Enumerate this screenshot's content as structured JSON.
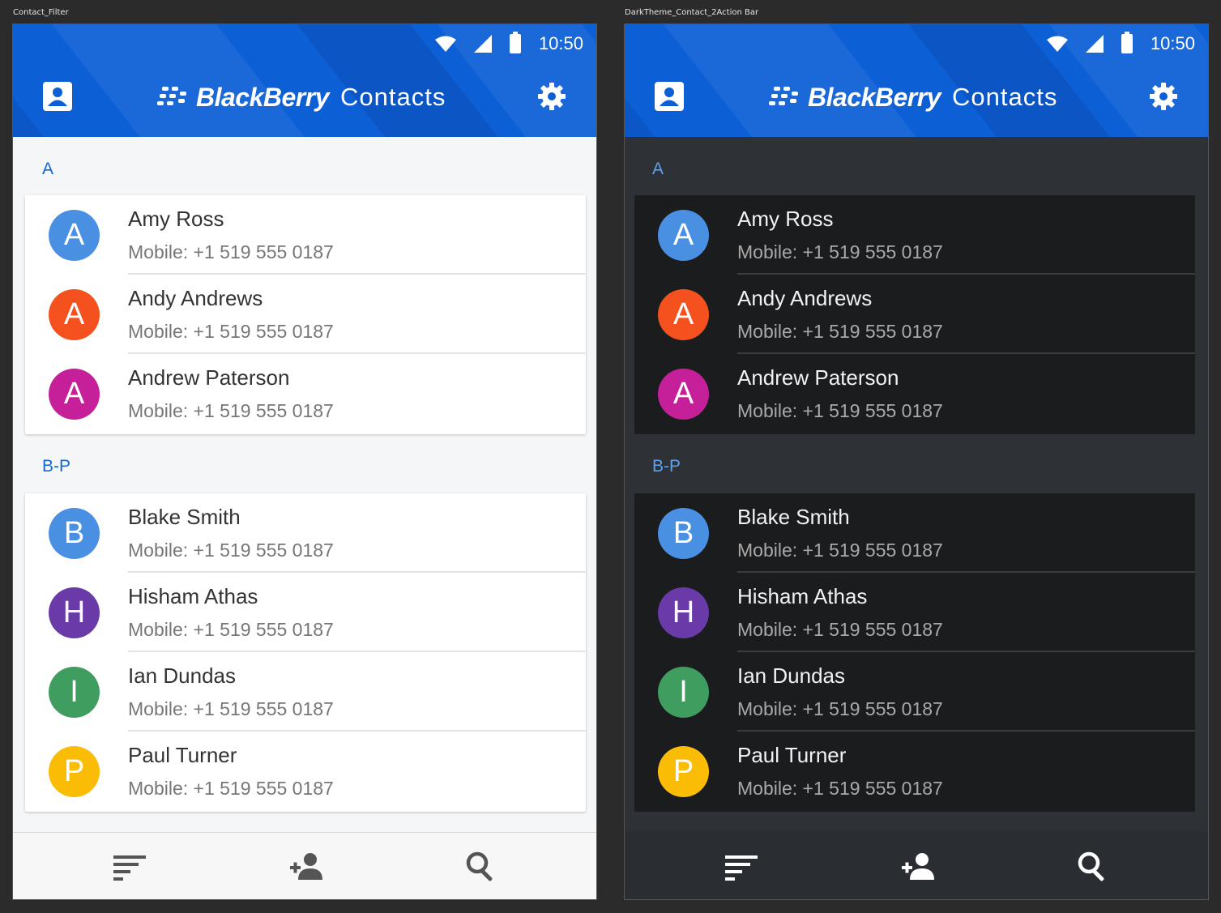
{
  "artboards": [
    {
      "title": "Contact_Filter",
      "theme": "light",
      "status": {
        "time": "10:50"
      },
      "header": {
        "brand": "BlackBerry",
        "app": "Contacts"
      },
      "sections": [
        {
          "label": "A",
          "contacts": [
            {
              "initial": "A",
              "name": "Amy Ross",
              "phone": "Mobile: +1 519 555 0187",
              "color": "#4a90e2"
            },
            {
              "initial": "A",
              "name": "Andy Andrews",
              "phone": "Mobile: +1 519 555 0187",
              "color": "#f4511e"
            },
            {
              "initial": "A",
              "name": "Andrew Paterson",
              "phone": "Mobile: +1 519 555 0187",
              "color": "#c51f9a"
            }
          ]
        },
        {
          "label": "B-P",
          "contacts": [
            {
              "initial": "B",
              "name": "Blake Smith",
              "phone": "Mobile: +1 519 555 0187",
              "color": "#4a90e2"
            },
            {
              "initial": "H",
              "name": "Hisham Athas",
              "phone": "Mobile: +1 519 555 0187",
              "color": "#6a3aa8"
            },
            {
              "initial": "I",
              "name": "Ian Dundas",
              "phone": "Mobile: +1 519 555 0187",
              "color": "#3f9e5f"
            },
            {
              "initial": "P",
              "name": "Paul Turner",
              "phone": "Mobile: +1 519 555 0187",
              "color": "#fbbc05"
            }
          ]
        }
      ],
      "bottom_bar": [
        "filter-icon",
        "add-contact-icon",
        "search-icon"
      ]
    },
    {
      "title": "DarkTheme_Contact_2Action Bar",
      "theme": "dark",
      "status": {
        "time": "10:50"
      },
      "header": {
        "brand": "BlackBerry",
        "app": "Contacts"
      },
      "sections": [
        {
          "label": "A",
          "contacts": [
            {
              "initial": "A",
              "name": "Amy Ross",
              "phone": "Mobile: +1 519 555 0187",
              "color": "#4a90e2"
            },
            {
              "initial": "A",
              "name": "Andy Andrews",
              "phone": "Mobile: +1 519 555 0187",
              "color": "#f4511e"
            },
            {
              "initial": "A",
              "name": "Andrew Paterson",
              "phone": "Mobile: +1 519 555 0187",
              "color": "#c51f9a"
            }
          ]
        },
        {
          "label": "B-P",
          "contacts": [
            {
              "initial": "B",
              "name": "Blake Smith",
              "phone": "Mobile: +1 519 555 0187",
              "color": "#4a90e2"
            },
            {
              "initial": "H",
              "name": "Hisham Athas",
              "phone": "Mobile: +1 519 555 0187",
              "color": "#6a3aa8"
            },
            {
              "initial": "I",
              "name": "Ian Dundas",
              "phone": "Mobile: +1 519 555 0187",
              "color": "#3f9e5f"
            },
            {
              "initial": "P",
              "name": "Paul Turner",
              "phone": "Mobile: +1 519 555 0187",
              "color": "#fbbc05"
            }
          ]
        }
      ],
      "bottom_bar": [
        "filter-icon",
        "add-contact-icon",
        "search-icon"
      ]
    }
  ]
}
